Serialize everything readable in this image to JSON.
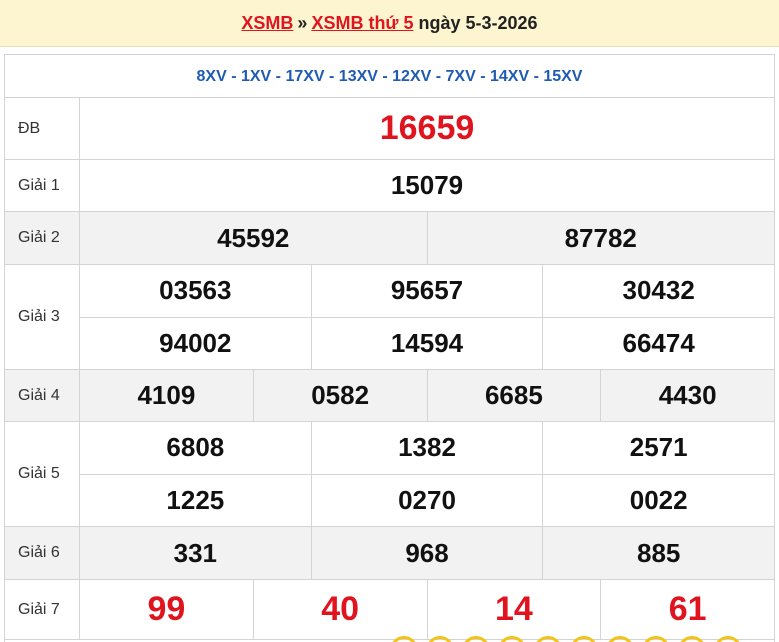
{
  "header": {
    "link_xsmb": "XSMB",
    "sep": "»",
    "link_weekday": "XSMB thứ 5",
    "date_text": "ngày 5-3-2026"
  },
  "codes": "8XV - 1XV - 17XV - 13XV - 12XV - 7XV - 14XV - 15XV",
  "prizes": {
    "db": {
      "label": "ĐB",
      "numbers": [
        "16659"
      ]
    },
    "g1": {
      "label": "Giải 1",
      "numbers": [
        "15079"
      ]
    },
    "g2": {
      "label": "Giải 2",
      "numbers": [
        "45592",
        "87782"
      ]
    },
    "g3": {
      "label": "Giải 3",
      "numbers": [
        "03563",
        "95657",
        "30432",
        "94002",
        "14594",
        "66474"
      ]
    },
    "g4": {
      "label": "Giải 4",
      "numbers": [
        "4109",
        "0582",
        "6685",
        "4430"
      ]
    },
    "g5": {
      "label": "Giải 5",
      "numbers": [
        "6808",
        "1382",
        "2571",
        "1225",
        "0270",
        "0022"
      ]
    },
    "g6": {
      "label": "Giải 6",
      "numbers": [
        "331",
        "968",
        "885"
      ]
    },
    "g7": {
      "label": "Giải 7",
      "numbers": [
        "99",
        "40",
        "14",
        "61"
      ]
    }
  },
  "colors": {
    "accent_red": "#e0141e",
    "code_blue": "#1f5bb0",
    "header_bg": "#fdf5cf"
  }
}
